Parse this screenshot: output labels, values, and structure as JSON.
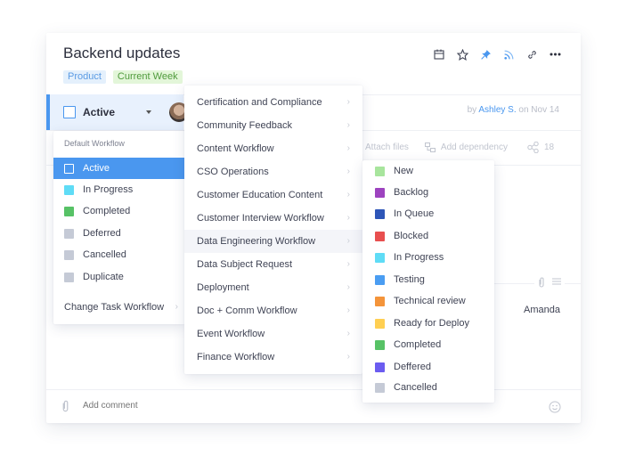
{
  "task": {
    "title": "Backend updates",
    "tags": [
      {
        "label": "Product",
        "color": "#5b9be4",
        "bg": "#e4f0fc"
      },
      {
        "label": "Current Week",
        "color": "#4f9a3c",
        "bg": "#e3f6d9"
      }
    ],
    "status": "Active",
    "author_prefix": "by",
    "author_name": "Ashley S.",
    "author_suffix": "on Nov 14",
    "attach_label": "Attach files",
    "dependency_label": "Add dependency",
    "share_count": "18",
    "assignee_visible": "Amanda",
    "comment_placeholder": "Add comment"
  },
  "toolbar": {
    "icons": [
      "calendar-icon",
      "star-icon",
      "pin-icon",
      "rss-icon",
      "link-icon",
      "more-icon"
    ],
    "accent": "#4a97ef"
  },
  "status_menu": {
    "header": "Default Workflow",
    "items": [
      {
        "label": "Active",
        "color": "#4a97ef",
        "selected": true
      },
      {
        "label": "In Progress",
        "color": "#5fdcf6"
      },
      {
        "label": "Completed",
        "color": "#57c266"
      },
      {
        "label": "Deferred",
        "color": "#c5cad6"
      },
      {
        "label": "Cancelled",
        "color": "#c5cad6"
      },
      {
        "label": "Duplicate",
        "color": "#c5cad6"
      }
    ],
    "change_workflow_label": "Change Task Workflow"
  },
  "workflow_menu": {
    "items": [
      {
        "label": "Certification and Compliance"
      },
      {
        "label": "Community Feedback"
      },
      {
        "label": "Content Workflow"
      },
      {
        "label": "CSO Operations"
      },
      {
        "label": "Customer Education Content"
      },
      {
        "label": "Customer Interview Workflow"
      },
      {
        "label": "Data Engineering Workflow",
        "hover": true
      },
      {
        "label": "Data Subject Request"
      },
      {
        "label": "Deployment"
      },
      {
        "label": "Doc + Comm Workflow"
      },
      {
        "label": "Event Workflow"
      },
      {
        "label": "Finance Workflow"
      }
    ]
  },
  "substatus_menu": {
    "items": [
      {
        "label": "New",
        "color": "#a8e59d"
      },
      {
        "label": "Backlog",
        "color": "#9d43bf"
      },
      {
        "label": "In Queue",
        "color": "#2e56b8"
      },
      {
        "label": "Blocked",
        "color": "#e84f4f"
      },
      {
        "label": "In Progress",
        "color": "#5fdcf6"
      },
      {
        "label": "Testing",
        "color": "#4a9df2"
      },
      {
        "label": "Technical review",
        "color": "#f4943a"
      },
      {
        "label": "Ready for Deploy",
        "color": "#ffcf52"
      },
      {
        "label": "Completed",
        "color": "#57c266"
      },
      {
        "label": "Deffered",
        "color": "#6b5cf0"
      },
      {
        "label": "Cancelled",
        "color": "#c5cad6"
      }
    ]
  }
}
